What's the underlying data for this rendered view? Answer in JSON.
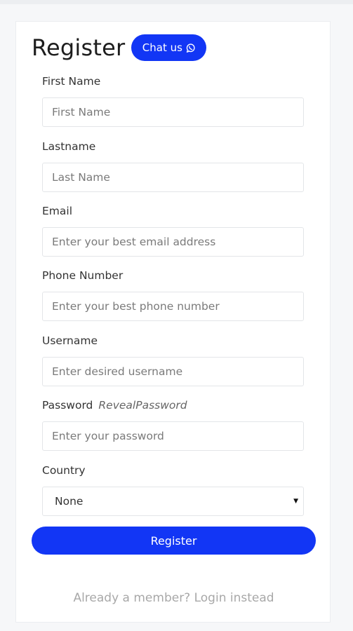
{
  "form": {
    "title": "Register",
    "chat_label": "Chat us",
    "chat_icon": "whatsapp-icon",
    "first_name": {
      "label": "First Name",
      "placeholder": "First Name"
    },
    "last_name": {
      "label": "Lastname",
      "placeholder": "Last Name"
    },
    "email": {
      "label": "Email",
      "placeholder": "Enter your best email address"
    },
    "phone": {
      "label": "Phone Number",
      "placeholder": "Enter your best phone number"
    },
    "username": {
      "label": "Username",
      "placeholder": "Enter desired username"
    },
    "password": {
      "label": "Password",
      "reveal_label": "RevealPassword",
      "placeholder": "Enter your password"
    },
    "country": {
      "label": "Country",
      "selected": "None"
    },
    "submit_label": "Register",
    "login_link": "Already a member? Login instead"
  },
  "colors": {
    "accent": "#1236f5",
    "background": "#f6f7f9",
    "card": "#ffffff"
  }
}
